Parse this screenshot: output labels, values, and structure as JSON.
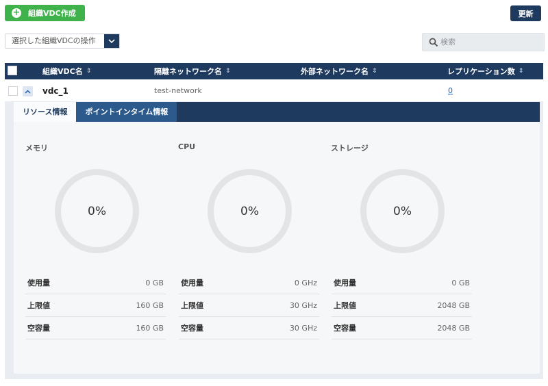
{
  "toolbar": {
    "create_label": "組織VDC作成",
    "refresh_label": "更新",
    "operation_label": "選択した組織VDCの操作",
    "search_placeholder": "検索"
  },
  "table": {
    "headers": [
      "組織VDC名",
      "隔離ネットワーク名",
      "外部ネットワーク名",
      "レプリケーション数"
    ],
    "rows": [
      {
        "name": "vdc_1",
        "isolated_network": "test-network",
        "external_network": "",
        "replication_count": "0"
      }
    ]
  },
  "detail": {
    "tabs": [
      "リソース情報",
      "ポイントインタイム情報"
    ],
    "sections": [
      {
        "title": "メモリ",
        "percent": "0%",
        "stats": [
          {
            "label": "使用量",
            "value": "0 GB"
          },
          {
            "label": "上限値",
            "value": "160 GB"
          },
          {
            "label": "空容量",
            "value": "160 GB"
          }
        ]
      },
      {
        "title": "CPU",
        "percent": "0%",
        "stats": [
          {
            "label": "使用量",
            "value": "0 GHz"
          },
          {
            "label": "上限値",
            "value": "30 GHz"
          },
          {
            "label": "空容量",
            "value": "30 GHz"
          }
        ]
      },
      {
        "title": "ストレージ",
        "percent": "0%",
        "stats": [
          {
            "label": "使用量",
            "value": "0 GB"
          },
          {
            "label": "上限値",
            "value": "2048 GB"
          },
          {
            "label": "空容量",
            "value": "2048 GB"
          }
        ]
      }
    ]
  },
  "colors": {
    "accent": "#1f3a5f",
    "create_button": "#3fb24c",
    "link": "#1f5fb8"
  },
  "icons": {
    "create": "plus-circle-icon",
    "operation": "chevron-down-icon",
    "search": "search-icon",
    "sort": "sort-icon",
    "expand": "chevron-up-icon"
  }
}
